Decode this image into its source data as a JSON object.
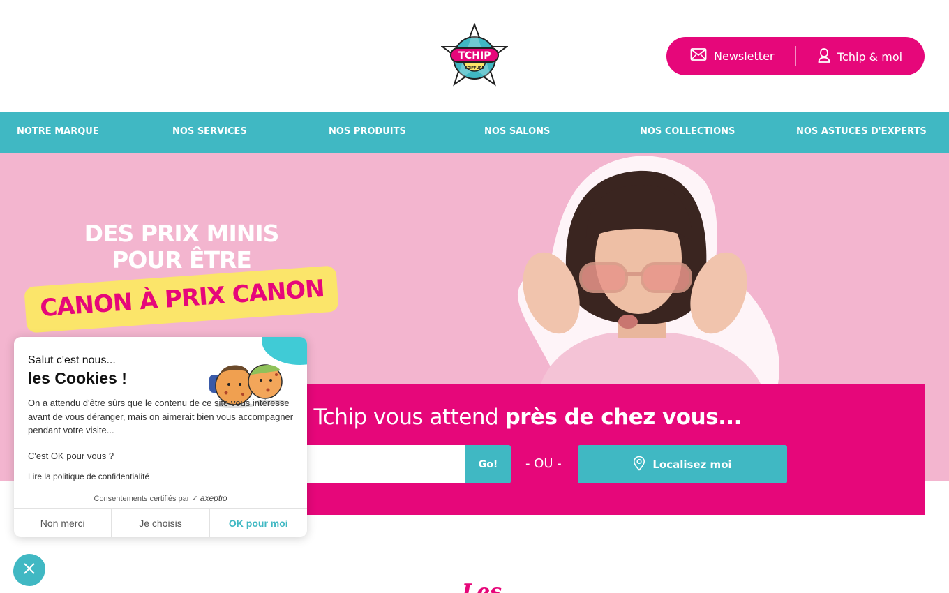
{
  "header": {
    "logo": {
      "text": "TCHIP",
      "subtext": "COIFFURE"
    },
    "actions": {
      "newsletter_label": "Newsletter",
      "account_label": "Tchip & moi"
    }
  },
  "nav": {
    "items": [
      {
        "label": "NOTRE MARQUE"
      },
      {
        "label": "NOS SERVICES"
      },
      {
        "label": "NOS PRODUITS"
      },
      {
        "label": "NOS SALONS"
      },
      {
        "label": "NOS COLLECTIONS"
      },
      {
        "label": "NOS ASTUCES D'EXPERTS"
      }
    ]
  },
  "hero": {
    "title_line1": "DES PRIX MINIS",
    "title_line2": "POUR ÊTRE",
    "banner": "CANON À PRIX CANON"
  },
  "finder": {
    "text_regular": "n Tchip vous attend ",
    "text_bold": "près de chez vous...",
    "input_value": "",
    "go_label": "Go!",
    "or_label": "- OU -",
    "locate_label": "Localisez moi"
  },
  "section": {
    "heading_fragment": "Les"
  },
  "cookie": {
    "hello": "Salut c'est nous...",
    "title": "les Cookies !",
    "body": "On a attendu d'être sûrs que le contenu de ce site vous intéresse avant de vous déranger, mais on aimerait bien vous accompagner pendant votre visite...",
    "ask": "C'est OK pour vous ?",
    "policy_link": "Lire la politique de confidentialité",
    "certified": "Consentements certifiés par",
    "certified_brand": "axeptio",
    "buttons": {
      "refuse": "Non merci",
      "choose": "Je choisis",
      "accept": "OK pour moi"
    }
  },
  "colors": {
    "brand_pink": "#e6077a",
    "brand_teal": "#40b8c3",
    "hero_bg": "#f3b5cf",
    "banner_yellow": "#fbe56a"
  },
  "icons": {
    "newsletter": "envelope-icon",
    "account": "user-icon",
    "locate": "map-pin-icon",
    "close": "close-icon"
  }
}
